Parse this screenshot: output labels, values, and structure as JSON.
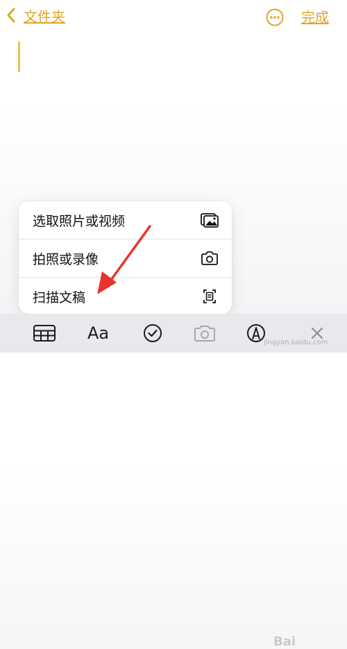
{
  "nav": {
    "back_label": "文件夹",
    "done_label": "完成"
  },
  "menu": {
    "items": [
      {
        "label": "选取照片或视频",
        "icon": "photo-library-icon"
      },
      {
        "label": "拍照或录像",
        "icon": "camera-icon"
      },
      {
        "label": "扫描文稿",
        "icon": "scan-document-icon"
      }
    ]
  },
  "toolbar": {
    "format_label": "Aa",
    "icons": [
      "table-icon",
      "checklist-icon",
      "camera-icon",
      "markup-pen-icon",
      "close-icon"
    ]
  },
  "watermark": {
    "logo_text": "Bai",
    "url_text": "jingyan.baidu.com"
  },
  "colors": {
    "accent": "#e2a625",
    "annotation_arrow": "#e8342c",
    "toolbar_bg": "#e9e9ed"
  }
}
